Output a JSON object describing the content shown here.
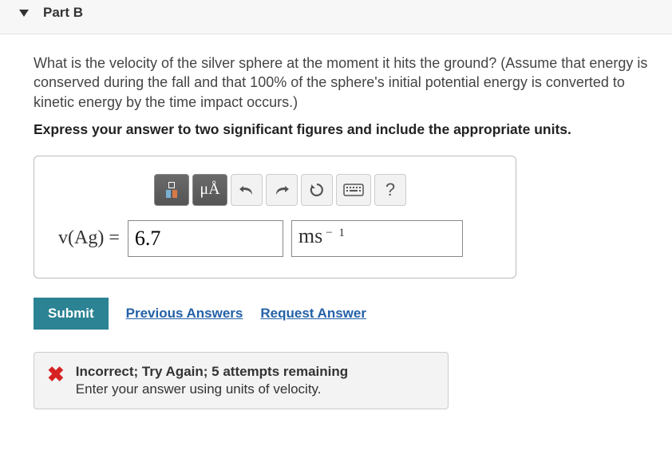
{
  "header": {
    "part_label": "Part B"
  },
  "question": {
    "text": "What is the velocity of the silver sphere at the moment it hits the ground? (Assume that energy is conserved during the fall and that 100% of the sphere's initial potential energy is converted to kinetic energy by the time impact occurs.)",
    "instruction": "Express your answer to two significant figures and include the appropriate units."
  },
  "toolbar": {
    "templates_btn": "templates",
    "special_chars_label": "μÅ",
    "undo": "undo",
    "redo": "redo",
    "reset": "reset",
    "keyboard": "keyboard",
    "help": "?"
  },
  "answer": {
    "var_label": "v(Ag) =",
    "value": "6.7",
    "units_base": "ms",
    "units_exp": "− 1"
  },
  "actions": {
    "submit": "Submit",
    "previous_answers": "Previous Answers",
    "request_answer": "Request Answer"
  },
  "feedback": {
    "status": "incorrect",
    "title": "Incorrect; Try Again; 5 attempts remaining",
    "message": "Enter your answer using units of velocity."
  }
}
